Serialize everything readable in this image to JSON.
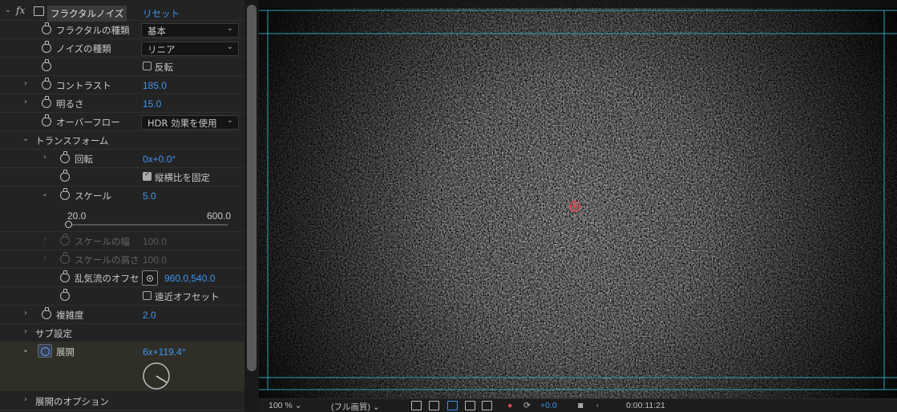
{
  "header": {
    "fx_label": "fx",
    "effect_name": "フラクタルノイズ",
    "reset_label": "リセット"
  },
  "properties": {
    "fractal_type": {
      "label": "フラクタルの種類",
      "value": "基本"
    },
    "noise_type": {
      "label": "ノイズの種類",
      "value": "リニア"
    },
    "invert": {
      "label": "反転",
      "checked": false
    },
    "contrast": {
      "label": "コントラスト",
      "value": "185.0"
    },
    "brightness": {
      "label": "明るさ",
      "value": "15.0"
    },
    "overflow": {
      "label": "オーバーフロー",
      "value": "HDR 効果を使用"
    },
    "transform": {
      "label": "トランスフォーム",
      "rotation": {
        "label": "回転",
        "value": "0x+0.0°"
      },
      "uniform_scaling": {
        "label": "縦横比を固定",
        "checked": true
      },
      "scale": {
        "label": "スケール",
        "value": "5.0",
        "slider_min": "20.0",
        "slider_max": "600.0"
      },
      "scale_width": {
        "label": "スケールの幅",
        "value": "100.0"
      },
      "scale_height": {
        "label": "スケールの高さ",
        "value": "100.0"
      },
      "offset": {
        "label": "乱気流のオフセ",
        "value": "960.0,540.0"
      },
      "perspective_offset": {
        "label": "遠近オフセット",
        "checked": false
      }
    },
    "complexity": {
      "label": "複雑度",
      "value": "2.0"
    },
    "sub_settings": {
      "label": "サブ設定"
    },
    "evolution": {
      "label": "展開",
      "value": "6x+119.4°"
    },
    "evolution_options": {
      "label": "展開のオプション"
    }
  },
  "viewer_bar": {
    "zoom": "100 %",
    "resolution": "(フル画質)",
    "exposure": "+0.0",
    "timecode": "0:00:11:21"
  },
  "colors": {
    "accent_blue": "#3e95f1",
    "guide_cyan": "#27a3b8",
    "anchor_red": "#e0454f"
  }
}
